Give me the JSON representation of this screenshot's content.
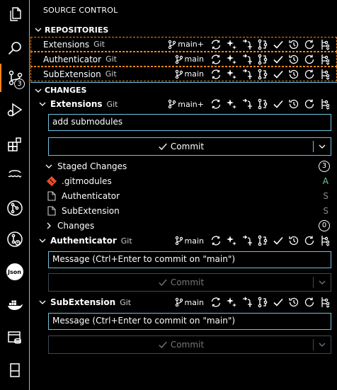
{
  "sidebar_title": "SOURCE CONTROL",
  "activity_bar": {
    "items": [
      {
        "name": "explorer-icon"
      },
      {
        "name": "search-icon"
      },
      {
        "name": "source-control-icon",
        "badge": "3"
      },
      {
        "name": "run-debug-icon"
      },
      {
        "name": "extensions-icon"
      },
      {
        "name": "wave-icon"
      },
      {
        "name": "git-graph-icon"
      },
      {
        "name": "git-history-icon"
      },
      {
        "name": "json-icon",
        "text": "Json"
      },
      {
        "name": "docker-icon"
      },
      {
        "name": "database-icon"
      },
      {
        "name": "panel-icon"
      }
    ]
  },
  "repositories": {
    "header": "REPOSITORIES",
    "items": [
      {
        "name": "Extensions",
        "provider": "Git",
        "branch": "main+"
      },
      {
        "name": "Authenticator",
        "provider": "Git",
        "branch": "main"
      },
      {
        "name": "SubExtension",
        "provider": "Git",
        "branch": "main"
      }
    ]
  },
  "changes": {
    "header": "CHANGES",
    "extensions": {
      "name": "Extensions",
      "provider": "Git",
      "branch": "main+",
      "message": "add submodules",
      "commit_label": "Commit",
      "staged": {
        "label": "Staged Changes",
        "count": "3",
        "files": [
          {
            "name": ".gitmodules",
            "status": "A",
            "status_color": "#73c991"
          },
          {
            "name": "Authenticator",
            "status": "S",
            "status_color": "#8c8c8c"
          },
          {
            "name": "SubExtension",
            "status": "S",
            "status_color": "#8c8c8c"
          }
        ]
      },
      "changes_group": {
        "label": "Changes",
        "count": "0"
      }
    },
    "authenticator": {
      "name": "Authenticator",
      "provider": "Git",
      "branch": "main",
      "placeholder": "Message (Ctrl+Enter to commit on \"main\")",
      "commit_label": "Commit"
    },
    "subextension": {
      "name": "SubExtension",
      "provider": "Git",
      "branch": "main",
      "placeholder": "Message (Ctrl+Enter to commit on \"main\")",
      "commit_label": "Commit"
    }
  },
  "colors": {
    "border": "#6fc3df",
    "focus": "#f38518",
    "added": "#73c991",
    "submodule": "#8c8c8c",
    "git_file": "#f14c28"
  }
}
